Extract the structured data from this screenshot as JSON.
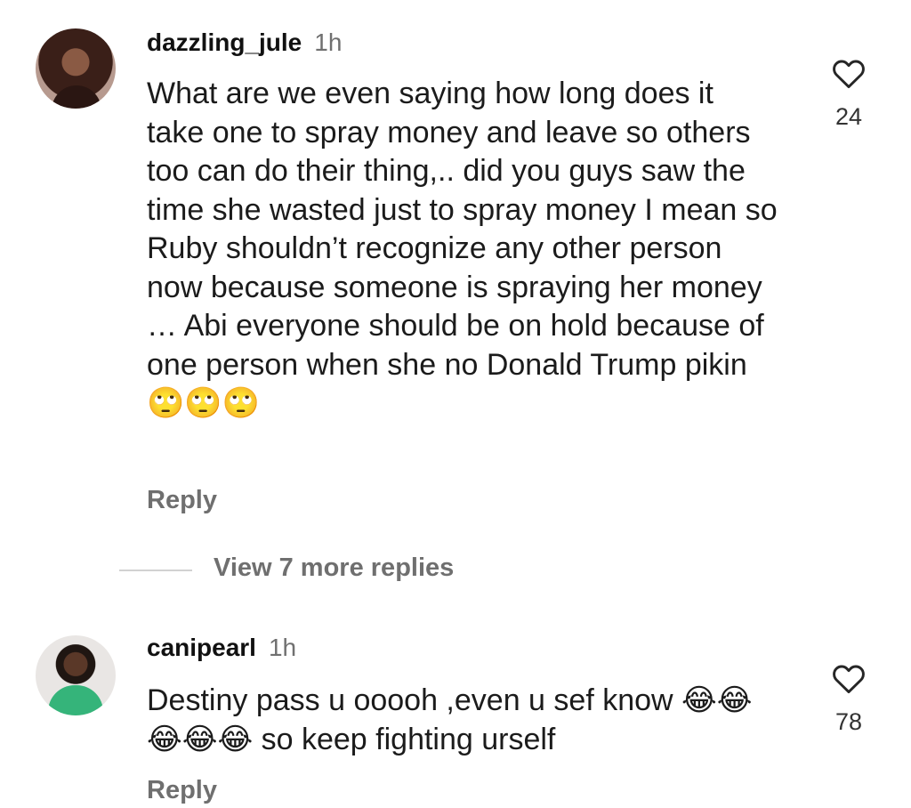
{
  "comments": [
    {
      "username": "dazzling_jule",
      "time": "1h",
      "text": "What are we even saying how long does it take one to spray money and leave so others too can do their thing,.. did you guys saw the time she wasted just to spray money I mean so Ruby shouldn’t recognize any other person now because someone is spraying her money … Abi everyone should be on hold because of one person when she no Donald Trump pikin 🙄🙄🙄",
      "likes": "24",
      "reply_label": "Reply"
    },
    {
      "username": "canipearl",
      "time": "1h",
      "text": "Destiny pass u ooooh ,even u sef know 😂😂😂😂😂 so keep fighting urself",
      "likes": "78",
      "reply_label": "Reply"
    }
  ],
  "view_more_replies": "View 7 more replies",
  "icons": {
    "like": "heart-outline-icon"
  }
}
